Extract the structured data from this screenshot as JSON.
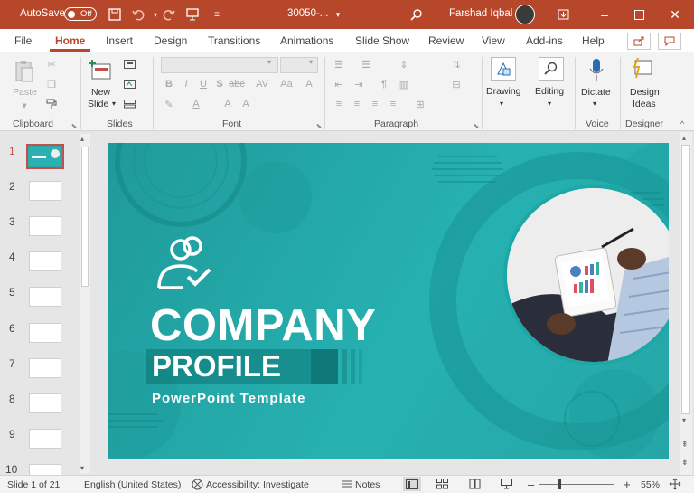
{
  "titlebar": {
    "autosave_label": "AutoSave",
    "autosave_state": "Off",
    "filename": "30050-...",
    "user": "Farshad Iqbal",
    "accent": "#b7472a"
  },
  "tabs": [
    "File",
    "Home",
    "Insert",
    "Design",
    "Transitions",
    "Animations",
    "Slide Show",
    "Review",
    "View",
    "Add-ins",
    "Help"
  ],
  "ribbon": {
    "groups": {
      "clipboard": "Clipboard",
      "slides": "Slides",
      "font": "Font",
      "paragraph": "Paragraph",
      "voice": "Voice",
      "designer": "Designer"
    },
    "paste": "Paste",
    "new_slide_1": "New",
    "new_slide_2": "Slide",
    "drawing": "Drawing",
    "editing": "Editing",
    "dictate": "Dictate",
    "design_ideas_1": "Design",
    "design_ideas_2": "Ideas"
  },
  "thumbnails": [
    "1",
    "2",
    "3",
    "4",
    "5",
    "6",
    "7",
    "8",
    "9",
    "10"
  ],
  "slide": {
    "title": "COMPANY",
    "subtitle_box": "PROFILE",
    "tagline": "PowerPoint Template"
  },
  "status": {
    "slide_of": "Slide 1 of 21",
    "language": "English (United States)",
    "accessibility": "Accessibility: Investigate",
    "notes": "Notes",
    "zoom": "55%"
  }
}
